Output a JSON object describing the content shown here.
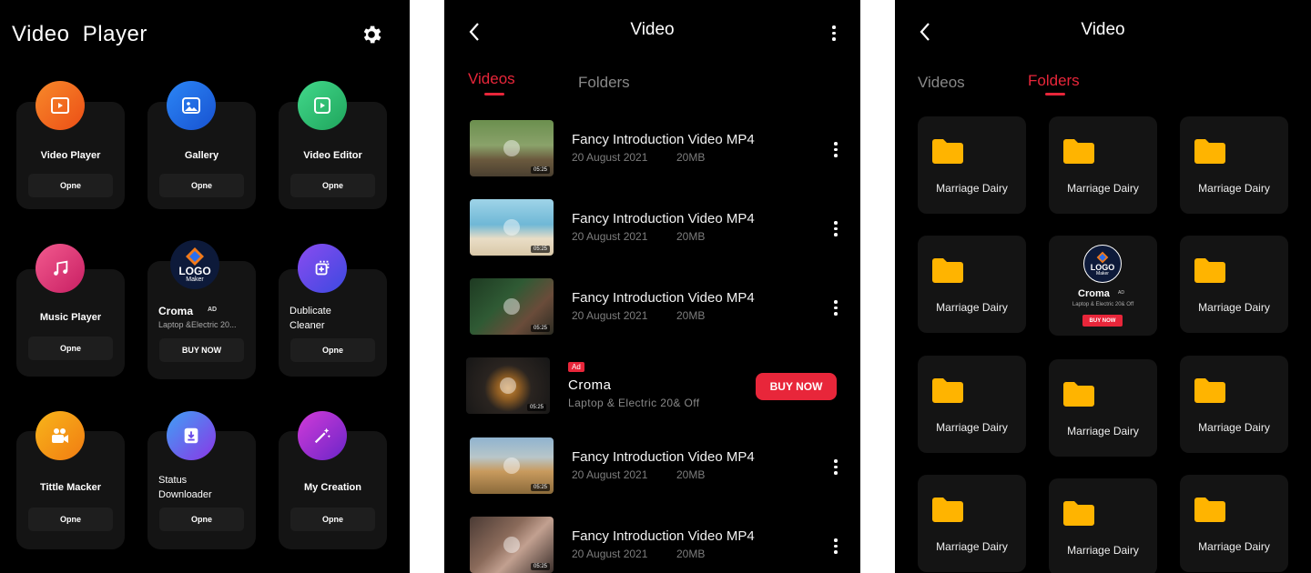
{
  "colors": {
    "accent": "#e8263a",
    "card": "#141414",
    "folder": "#ffb400"
  },
  "screen1": {
    "title": "Video  Player",
    "settings_icon": "gear-icon",
    "cards": [
      {
        "label": "Video Player",
        "button": "Opne",
        "icon": "film-icon",
        "color": "#f26a1b"
      },
      {
        "label": "Gallery",
        "button": "Opne",
        "icon": "image-icon",
        "color": "#1f6fe6"
      },
      {
        "label": "Video Editor",
        "button": "Opne",
        "icon": "edit-video-icon",
        "color": "#2fbf71"
      },
      {
        "label": "Music Player",
        "button": "Opne",
        "icon": "music-note-icon",
        "color": "#e53a7b"
      },
      {
        "label": "Croma",
        "ad": "AD",
        "sub": "Laptop &Electric 20...",
        "button": "BUY NOW",
        "logo_top": "LOGO",
        "logo_bottom": "Maker"
      },
      {
        "label": "Dublicate Cleaner",
        "label_line1": "Dublicate",
        "label_line2": "Cleaner",
        "button": "Opne",
        "icon": "duplicate-icon",
        "color": "#6a3ee6"
      },
      {
        "label": "Tittle Macker",
        "button": "Opne",
        "icon": "camera-icon",
        "color": "#f5a20c"
      },
      {
        "label": "Status Downloader",
        "label_line1": "Status",
        "label_line2": "Downloader",
        "button": "Opne",
        "icon": "download-icon",
        "color": "#7046f0"
      },
      {
        "label": "My Creation",
        "button": "Opne",
        "icon": "magic-wand-icon",
        "color": "#b01cc9"
      }
    ]
  },
  "screen2": {
    "title": "Video",
    "tabs": {
      "videos": "Videos",
      "folders": "Folders"
    },
    "videos": [
      {
        "title": "Fancy Introduction Video MP4",
        "date": "20 August 2021",
        "size": "20MB",
        "duration": "05:25"
      },
      {
        "title": "Fancy Introduction Video MP4",
        "date": "20 August 2021",
        "size": "20MB",
        "duration": "05:25"
      },
      {
        "title": "Fancy Introduction Video MP4",
        "date": "20 August 2021",
        "size": "20MB",
        "duration": "05:25"
      },
      {
        "title": "Fancy Introduction Video MP4",
        "date": "20 August 2021",
        "size": "20MB",
        "duration": "05:25"
      },
      {
        "title": "Fancy Introduction Video MP4",
        "date": "20 August 2021",
        "size": "20MB",
        "duration": "05:25"
      }
    ],
    "ad": {
      "badge": "Ad",
      "title": "Croma",
      "desc": "Laptop & Electric 20& Off",
      "button": "BUY NOW",
      "duration": "05:25"
    }
  },
  "screen3": {
    "title": "Video",
    "tabs": {
      "videos": "Videos",
      "folders": "Folders"
    },
    "folder_label": "Marriage Dairy",
    "ad": {
      "logo_top": "LOGO",
      "logo_bottom": "Maker",
      "title": "Croma",
      "badge": "AD",
      "desc": "Laptop & Electric 20& Off",
      "button": "BUY NOW"
    }
  }
}
